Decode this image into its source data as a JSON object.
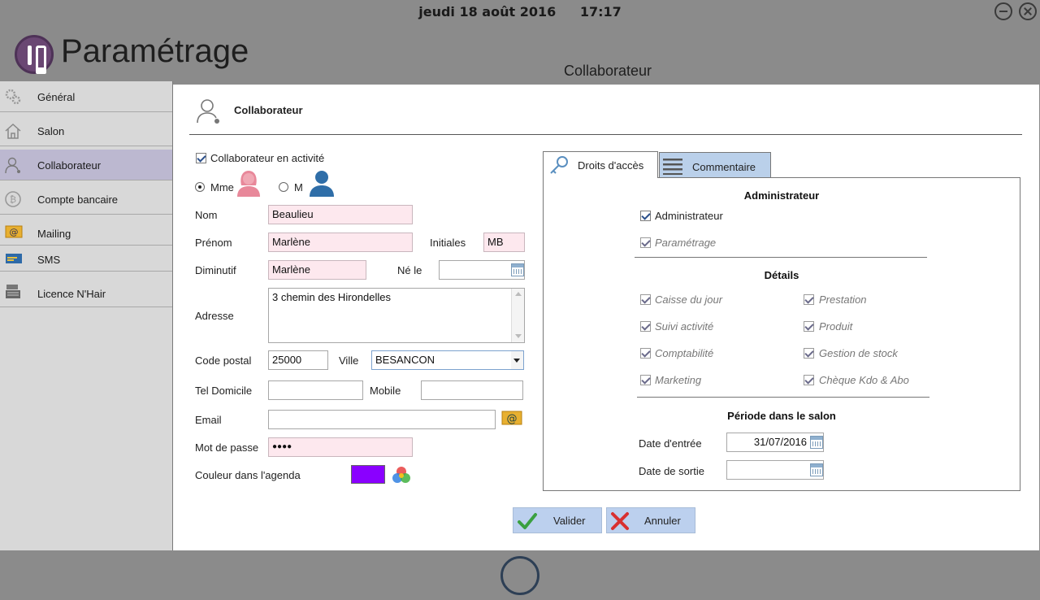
{
  "topbar": {
    "date": "jeudi 18 août 2016",
    "time": "17:17"
  },
  "app": {
    "title": "Paramétrage",
    "page_heading": "Collaborateur"
  },
  "sidebar": {
    "items": [
      {
        "label": "Général",
        "icon": "gears-icon"
      },
      {
        "label": "Salon",
        "icon": "house-icon"
      },
      {
        "label": "Collaborateur",
        "icon": "user-icon",
        "active": true
      },
      {
        "label": "Compte bancaire",
        "icon": "bitcoin-coin-icon"
      },
      {
        "label": "Mailing",
        "icon": "at-envelope-icon"
      },
      {
        "label": "SMS",
        "icon": "sms-card-icon"
      },
      {
        "label": "Licence N'Hair",
        "icon": "register-icon"
      }
    ]
  },
  "section": {
    "title": "Collaborateur"
  },
  "form": {
    "active_label": "Collaborateur en activité",
    "mme_label": "Mme",
    "m_label": "M",
    "nom_label": "Nom",
    "nom_value": "Beaulieu",
    "prenom_label": "Prénom",
    "prenom_value": "Marlène",
    "initiales_label": "Initiales",
    "initiales_value": "MB",
    "diminutif_label": "Diminutif",
    "diminutif_value": "Marlène",
    "ne_le_label": "Né le",
    "ne_le_value": "",
    "adresse_label": "Adresse",
    "adresse_value": "3 chemin des Hirondelles",
    "cp_label": "Code postal",
    "cp_value": "25000",
    "ville_label": "Ville",
    "ville_value": "BESANCON",
    "tel_label": "Tel Domicile",
    "tel_value": "",
    "mobile_label": "Mobile",
    "mobile_value": "",
    "email_label": "Email",
    "email_value": "",
    "mdp_label": "Mot de passe",
    "mdp_value": "●●●●",
    "couleur_label": "Couleur dans l'agenda",
    "couleur_value": "#8a00ff"
  },
  "tabs": {
    "droits": "Droits d'accès",
    "commentaire": "Commentaire"
  },
  "droits": {
    "admin_heading": "Administrateur",
    "admin_label": "Administrateur",
    "parametrage_label": "Paramétrage",
    "details_heading": "Détails",
    "left": [
      "Caisse du jour",
      "Suivi activité",
      "Comptabilité",
      "Marketing"
    ],
    "right": [
      "Prestation",
      "Produit",
      "Gestion de stock",
      "Chèque Kdo & Abo"
    ],
    "periode_heading": "Période dans le salon",
    "entree_label": "Date d'entrée",
    "entree_value": "31/07/2016",
    "sortie_label": "Date de sortie",
    "sortie_value": ""
  },
  "actions": {
    "valider": "Valider",
    "annuler": "Annuler"
  },
  "colors": {
    "accent": "#bcd0ee",
    "required_bg": "#fde8ee",
    "active_sidebar": "#bcb8d0",
    "agenda_color": "#8a00ff"
  }
}
